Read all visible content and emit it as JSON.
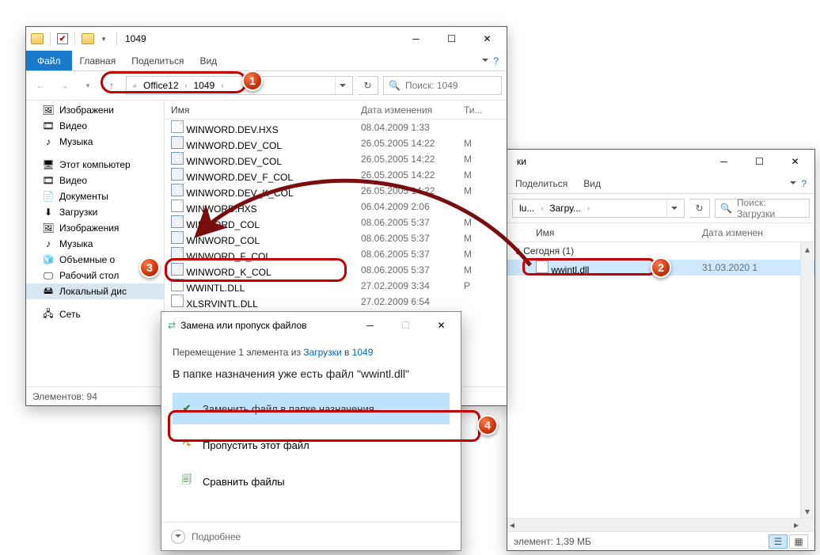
{
  "win1": {
    "title": "1049",
    "tabs": {
      "file": "Файл",
      "home": "Главная",
      "share": "Поделиться",
      "view": "Вид"
    },
    "breadcrumbs": [
      "Office12",
      "1049"
    ],
    "search_placeholder": "Поиск: 1049",
    "columns": {
      "name": "Имя",
      "modified": "Дата изменения",
      "type": "Ти..."
    },
    "nav": [
      {
        "label": "Изображени",
        "icon": "pictures"
      },
      {
        "label": "Видео",
        "icon": "video"
      },
      {
        "label": "Музыка",
        "icon": "music"
      },
      {
        "label": "",
        "icon": ""
      },
      {
        "label": "Этот компьютер",
        "icon": "pc"
      },
      {
        "label": "Видео",
        "icon": "video"
      },
      {
        "label": "Документы",
        "icon": "docs"
      },
      {
        "label": "Загрузки",
        "icon": "downloads"
      },
      {
        "label": "Изображения",
        "icon": "pictures"
      },
      {
        "label": "Музыка",
        "icon": "music"
      },
      {
        "label": "Объемные о",
        "icon": "cube"
      },
      {
        "label": "Рабочий стол",
        "icon": "desktop"
      },
      {
        "label": "Локальный дис",
        "icon": "disk",
        "selected": true
      },
      {
        "label": "",
        "icon": ""
      },
      {
        "label": "Сеть",
        "icon": "network"
      }
    ],
    "rows": [
      {
        "name": "WINWORD.DEV.HXS",
        "date": "08.04.2009 1:33",
        "type": "",
        "ico": "hxs"
      },
      {
        "name": "WINWORD.DEV_COL",
        "date": "26.05.2005 14:22",
        "type": "M",
        "ico": "col"
      },
      {
        "name": "WINWORD.DEV_COL",
        "date": "26.05.2005 14:22",
        "type": "M",
        "ico": "col"
      },
      {
        "name": "WINWORD.DEV_F_COL",
        "date": "26.05.2005 14:22",
        "type": "M",
        "ico": "col"
      },
      {
        "name": "WINWORD.DEV_K_COL",
        "date": "26.05.2005 14:22",
        "type": "M",
        "ico": "col"
      },
      {
        "name": "WINWORD.HXS",
        "date": "06.04.2009 2:06",
        "type": "",
        "ico": "hxs"
      },
      {
        "name": "WINWORD_COL",
        "date": "08.06.2005 5:37",
        "type": "M",
        "ico": "col"
      },
      {
        "name": "WINWORD_COL",
        "date": "08.06.2005 5:37",
        "type": "M",
        "ico": "col"
      },
      {
        "name": "WINWORD_F_COL",
        "date": "08.06.2005 5:37",
        "type": "M",
        "ico": "col"
      },
      {
        "name": "WINWORD_K_COL",
        "date": "08.06.2005 5:37",
        "type": "M",
        "ico": "col"
      },
      {
        "name": "WWINTL.DLL",
        "date": "27.02.2009 3:34",
        "type": "Р",
        "ico": "dll"
      },
      {
        "name": "XLSRVINTL.DLL",
        "date": "27.02.2009 6:54",
        "type": "",
        "ico": "dll"
      }
    ],
    "status": "Элементов: 94"
  },
  "win2": {
    "title_suffix": "ки",
    "tabs": {
      "share": "Поделиться",
      "view": "Вид"
    },
    "breadcrumbs": [
      "lu...",
      "Загру..."
    ],
    "search_placeholder": "Поиск: Загрузки",
    "columns": {
      "name": "Имя",
      "modified": "Дата изменен"
    },
    "group": "Сегодня (1)",
    "rows": [
      {
        "name": "wwintl.dll",
        "date": "31.03.2020 1",
        "ico": "dll",
        "selected": true
      }
    ],
    "status_left": "элемент: 1,39 МБ"
  },
  "dialog": {
    "title": "Замена или пропуск файлов",
    "subtitle_prefix": "Перемещение 1 элемента из ",
    "subtitle_link1": "Загрузки",
    "subtitle_mid": " в ",
    "subtitle_link2": "1049",
    "message": "В папке назначения уже есть файл \"wwintl.dll\"",
    "opt_replace": "Заменить файл в папке назначения",
    "opt_skip": "Пропустить этот файл",
    "opt_compare": "Сравнить файлы",
    "more": "Подробнее"
  },
  "badges": {
    "1": "1",
    "2": "2",
    "3": "3",
    "4": "4"
  }
}
